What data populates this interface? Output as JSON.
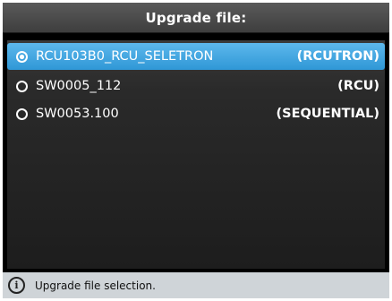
{
  "title": "Upgrade file:",
  "files": [
    {
      "name": "RCU103B0_RCU_SELETRON",
      "type": "(RCUTRON)",
      "selected": true
    },
    {
      "name": "SW0005_112",
      "type": "(RCU)",
      "selected": false
    },
    {
      "name": "SW0053.100",
      "type": "(SEQUENTIAL)",
      "selected": false
    }
  ],
  "status": {
    "icon": "info-icon",
    "text": "Upgrade file selection."
  },
  "colors": {
    "selection": "#3ea6e2",
    "status_bar": "#cfd4d8",
    "background": "#000000"
  }
}
